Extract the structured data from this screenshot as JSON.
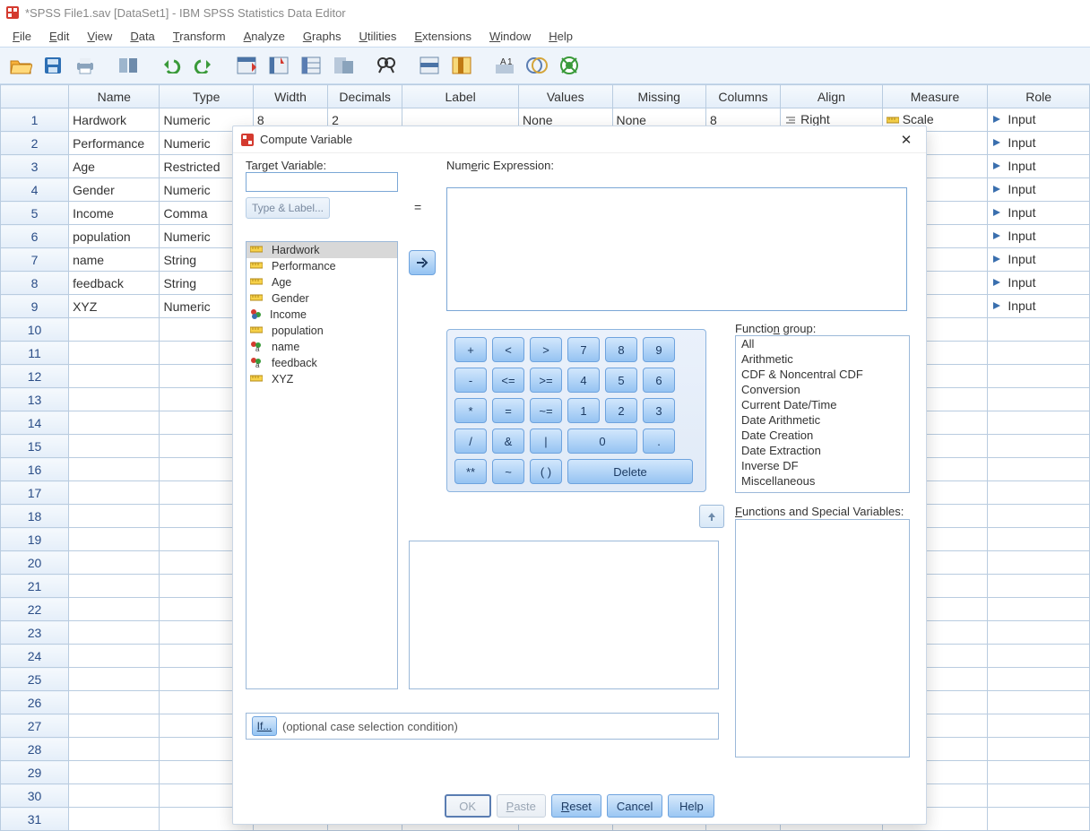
{
  "window": {
    "title": "*SPSS File1.sav [DataSet1] - IBM SPSS Statistics Data Editor"
  },
  "menus": [
    "File",
    "Edit",
    "View",
    "Data",
    "Transform",
    "Analyze",
    "Graphs",
    "Utilities",
    "Extensions",
    "Window",
    "Help"
  ],
  "columns": [
    "Name",
    "Type",
    "Width",
    "Decimals",
    "Label",
    "Values",
    "Missing",
    "Columns",
    "Align",
    "Measure",
    "Role"
  ],
  "rows": [
    {
      "n": "1",
      "name": "Hardwork",
      "type": "Numeric",
      "width": "8",
      "dec": "2",
      "label": "",
      "values": "None",
      "missing": "None",
      "cols": "8",
      "align": "Right",
      "measure": "Scale",
      "role": "Input"
    },
    {
      "n": "2",
      "name": "Performance",
      "type": "Numeric",
      "width": "",
      "dec": "",
      "label": "",
      "values": "",
      "missing": "",
      "cols": "",
      "align": "",
      "measure": "le",
      "role": "Input"
    },
    {
      "n": "3",
      "name": "Age",
      "type": "Restricted",
      "width": "",
      "dec": "",
      "label": "",
      "values": "",
      "missing": "",
      "cols": "",
      "align": "",
      "measure": "le",
      "role": "Input"
    },
    {
      "n": "4",
      "name": "Gender",
      "type": "Numeric",
      "width": "",
      "dec": "",
      "label": "",
      "values": "",
      "missing": "",
      "cols": "",
      "align": "",
      "measure": "le",
      "role": "Input"
    },
    {
      "n": "5",
      "name": "Income",
      "type": "Comma",
      "width": "",
      "dec": "",
      "label": "",
      "values": "",
      "missing": "",
      "cols": "",
      "align": "",
      "measure": "inal",
      "role": "Input"
    },
    {
      "n": "6",
      "name": "population",
      "type": "Numeric",
      "width": "",
      "dec": "",
      "label": "",
      "values": "",
      "missing": "",
      "cols": "",
      "align": "",
      "measure": "le",
      "role": "Input"
    },
    {
      "n": "7",
      "name": "name",
      "type": "String",
      "width": "",
      "dec": "",
      "label": "",
      "values": "",
      "missing": "",
      "cols": "",
      "align": "",
      "measure": "inal",
      "role": "Input"
    },
    {
      "n": "8",
      "name": "feedback",
      "type": "String",
      "width": "",
      "dec": "",
      "label": "",
      "values": "",
      "missing": "",
      "cols": "",
      "align": "",
      "measure": "inal",
      "role": "Input"
    },
    {
      "n": "9",
      "name": "XYZ",
      "type": "Numeric",
      "width": "",
      "dec": "",
      "label": "",
      "values": "",
      "missing": "",
      "cols": "",
      "align": "",
      "measure": "le",
      "role": "Input"
    }
  ],
  "empty_rows": [
    "10",
    "11",
    "12",
    "13",
    "14",
    "15",
    "16",
    "17",
    "18",
    "19",
    "20",
    "21",
    "22",
    "23",
    "24",
    "25",
    "26",
    "27",
    "28",
    "29",
    "30",
    "31"
  ],
  "dialog": {
    "title": "Compute Variable",
    "target_label": "Target Variable:",
    "target_value": "",
    "type_label_btn": "Type & Label...",
    "equals": "=",
    "expr_label": "Numeric Expression:",
    "vars": [
      {
        "icon": "ruler",
        "label": "Hardwork",
        "sel": true
      },
      {
        "icon": "ruler",
        "label": "Performance"
      },
      {
        "icon": "ruler",
        "label": "Age"
      },
      {
        "icon": "ruler",
        "label": "Gender"
      },
      {
        "icon": "nominal",
        "label": "Income"
      },
      {
        "icon": "ruler",
        "label": "population"
      },
      {
        "icon": "nominal-a",
        "label": "name"
      },
      {
        "icon": "nominal-a",
        "label": "feedback"
      },
      {
        "icon": "ruler",
        "label": "XYZ"
      }
    ],
    "keypad": {
      "r1": [
        "+",
        "<",
        ">",
        "7",
        "8",
        "9"
      ],
      "r2": [
        "-",
        "<=",
        ">=",
        "4",
        "5",
        "6"
      ],
      "r3": [
        "*",
        "=",
        "~=",
        "1",
        "2",
        "3"
      ],
      "r4": [
        "/",
        "&",
        "|",
        "0",
        "."
      ],
      "r5": [
        "**",
        "~",
        "( )",
        "Delete"
      ]
    },
    "func_group_label": "Function group:",
    "func_groups": [
      "All",
      "Arithmetic",
      "CDF & Noncentral CDF",
      "Conversion",
      "Current Date/Time",
      "Date Arithmetic",
      "Date Creation",
      "Date Extraction",
      "Inverse DF",
      "Miscellaneous"
    ],
    "spec_label": "Functions and Special Variables:",
    "if_btn": "If...",
    "if_text": "(optional case selection condition)",
    "buttons": {
      "ok": "OK",
      "paste": "Paste",
      "reset": "Reset",
      "cancel": "Cancel",
      "help": "Help"
    }
  }
}
